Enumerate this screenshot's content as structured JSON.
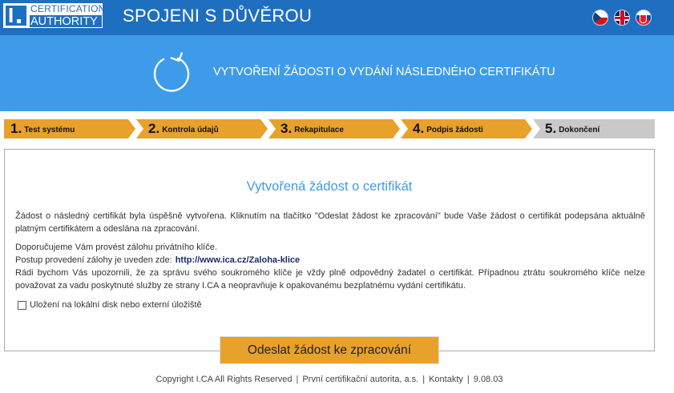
{
  "header": {
    "logo_certification": "CERTIFICATION",
    "logo_authority": "AUTHORITY",
    "site_title": "SPOJENI S DŮVĚROU",
    "languages": [
      "cz-flag-icon",
      "gb-flag-icon",
      "sk-flag-icon"
    ],
    "color_bar": "#1f6fc0"
  },
  "banner": {
    "icon": "refresh-icon",
    "title": "VYTVOŘENÍ ŽÁDOSTI O VYDÁNÍ NÁSLEDNÉHO CERTIFIKÁTU",
    "color": "#3e9bea"
  },
  "steps": [
    {
      "num": "1.",
      "label": "Test systému",
      "state": "done"
    },
    {
      "num": "2.",
      "label": "Kontrola údajů",
      "state": "done"
    },
    {
      "num": "3.",
      "label": "Rekapitulace",
      "state": "done"
    },
    {
      "num": "4.",
      "label": "Podpis žádosti",
      "state": "done"
    },
    {
      "num": "5.",
      "label": "Dokončení",
      "state": "current"
    }
  ],
  "step_colors": {
    "done": "#e8a12a",
    "current": "#c9c9c9"
  },
  "panel": {
    "title": "Vytvořená žádost o certifikát",
    "p1": "Žádost o následný certifikát byla úspěšně vytvořena. Kliknutím na tlačítko \"Odeslat žádost ke zpracování\" bude Vaše žádost o certifikát podepsána aktuálně platným certifikátem a odeslána na zpracování.",
    "p2": "Doporučujeme Vám provést zálohu privátního klíče.",
    "p3_prefix": "Postup provedení zálohy je uveden zde:",
    "p3_link": "http://www.ica.cz/Zaloha-klice",
    "p4": "Rádi bychom Vás upozornili, že za správu svého soukromého klíče je vždy plně odpovědný žadatel o certifikát. Případnou ztrátu soukromého klíče nelze považovat za vadu poskytnuté služby ze strany I.CA a neopravňuje k opakovanému bezplatnému vydání certifikátu.",
    "checkbox_label": "Uložení na lokální disk nebo externí úložiště",
    "checkbox_checked": false
  },
  "submit_label": "Odeslat žádost ke zpracování",
  "footer": {
    "copyright": "Copyright I.CA All Rights Reserved",
    "company": "První certifikační autorita, a.s.",
    "contacts": "Kontakty",
    "version": "9.08.03"
  }
}
